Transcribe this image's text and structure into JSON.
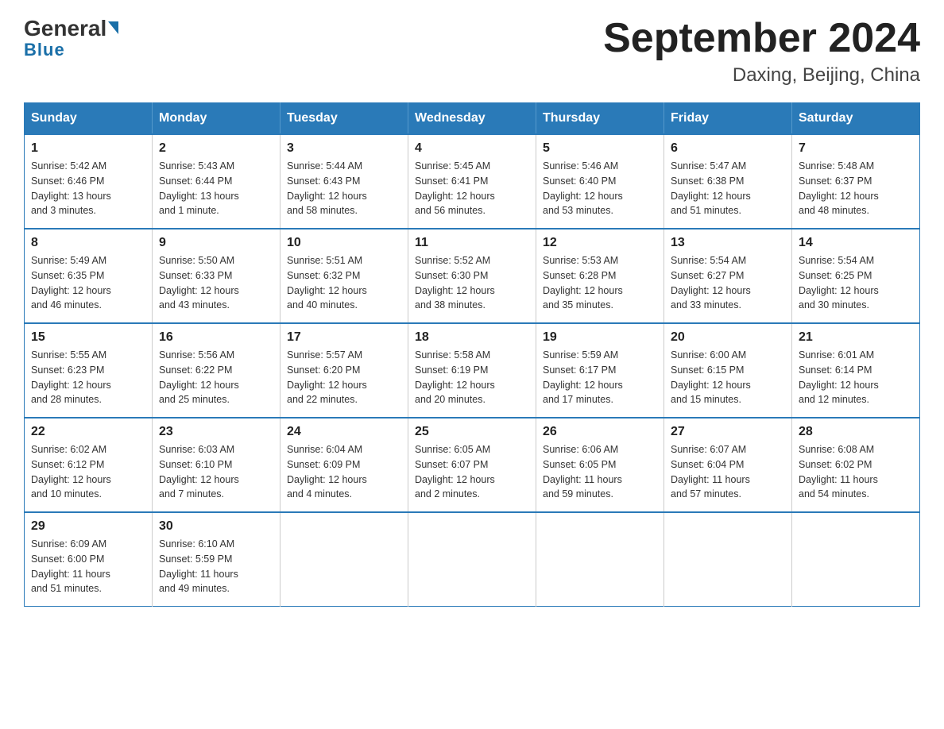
{
  "header": {
    "logo_general": "General",
    "logo_blue": "Blue",
    "title": "September 2024",
    "subtitle": "Daxing, Beijing, China"
  },
  "calendar": {
    "days_of_week": [
      "Sunday",
      "Monday",
      "Tuesday",
      "Wednesday",
      "Thursday",
      "Friday",
      "Saturday"
    ],
    "weeks": [
      [
        {
          "day": "1",
          "sunrise": "5:42 AM",
          "sunset": "6:46 PM",
          "daylight": "13 hours and 3 minutes."
        },
        {
          "day": "2",
          "sunrise": "5:43 AM",
          "sunset": "6:44 PM",
          "daylight": "13 hours and 1 minute."
        },
        {
          "day": "3",
          "sunrise": "5:44 AM",
          "sunset": "6:43 PM",
          "daylight": "12 hours and 58 minutes."
        },
        {
          "day": "4",
          "sunrise": "5:45 AM",
          "sunset": "6:41 PM",
          "daylight": "12 hours and 56 minutes."
        },
        {
          "day": "5",
          "sunrise": "5:46 AM",
          "sunset": "6:40 PM",
          "daylight": "12 hours and 53 minutes."
        },
        {
          "day": "6",
          "sunrise": "5:47 AM",
          "sunset": "6:38 PM",
          "daylight": "12 hours and 51 minutes."
        },
        {
          "day": "7",
          "sunrise": "5:48 AM",
          "sunset": "6:37 PM",
          "daylight": "12 hours and 48 minutes."
        }
      ],
      [
        {
          "day": "8",
          "sunrise": "5:49 AM",
          "sunset": "6:35 PM",
          "daylight": "12 hours and 46 minutes."
        },
        {
          "day": "9",
          "sunrise": "5:50 AM",
          "sunset": "6:33 PM",
          "daylight": "12 hours and 43 minutes."
        },
        {
          "day": "10",
          "sunrise": "5:51 AM",
          "sunset": "6:32 PM",
          "daylight": "12 hours and 40 minutes."
        },
        {
          "day": "11",
          "sunrise": "5:52 AM",
          "sunset": "6:30 PM",
          "daylight": "12 hours and 38 minutes."
        },
        {
          "day": "12",
          "sunrise": "5:53 AM",
          "sunset": "6:28 PM",
          "daylight": "12 hours and 35 minutes."
        },
        {
          "day": "13",
          "sunrise": "5:54 AM",
          "sunset": "6:27 PM",
          "daylight": "12 hours and 33 minutes."
        },
        {
          "day": "14",
          "sunrise": "5:54 AM",
          "sunset": "6:25 PM",
          "daylight": "12 hours and 30 minutes."
        }
      ],
      [
        {
          "day": "15",
          "sunrise": "5:55 AM",
          "sunset": "6:23 PM",
          "daylight": "12 hours and 28 minutes."
        },
        {
          "day": "16",
          "sunrise": "5:56 AM",
          "sunset": "6:22 PM",
          "daylight": "12 hours and 25 minutes."
        },
        {
          "day": "17",
          "sunrise": "5:57 AM",
          "sunset": "6:20 PM",
          "daylight": "12 hours and 22 minutes."
        },
        {
          "day": "18",
          "sunrise": "5:58 AM",
          "sunset": "6:19 PM",
          "daylight": "12 hours and 20 minutes."
        },
        {
          "day": "19",
          "sunrise": "5:59 AM",
          "sunset": "6:17 PM",
          "daylight": "12 hours and 17 minutes."
        },
        {
          "day": "20",
          "sunrise": "6:00 AM",
          "sunset": "6:15 PM",
          "daylight": "12 hours and 15 minutes."
        },
        {
          "day": "21",
          "sunrise": "6:01 AM",
          "sunset": "6:14 PM",
          "daylight": "12 hours and 12 minutes."
        }
      ],
      [
        {
          "day": "22",
          "sunrise": "6:02 AM",
          "sunset": "6:12 PM",
          "daylight": "12 hours and 10 minutes."
        },
        {
          "day": "23",
          "sunrise": "6:03 AM",
          "sunset": "6:10 PM",
          "daylight": "12 hours and 7 minutes."
        },
        {
          "day": "24",
          "sunrise": "6:04 AM",
          "sunset": "6:09 PM",
          "daylight": "12 hours and 4 minutes."
        },
        {
          "day": "25",
          "sunrise": "6:05 AM",
          "sunset": "6:07 PM",
          "daylight": "12 hours and 2 minutes."
        },
        {
          "day": "26",
          "sunrise": "6:06 AM",
          "sunset": "6:05 PM",
          "daylight": "11 hours and 59 minutes."
        },
        {
          "day": "27",
          "sunrise": "6:07 AM",
          "sunset": "6:04 PM",
          "daylight": "11 hours and 57 minutes."
        },
        {
          "day": "28",
          "sunrise": "6:08 AM",
          "sunset": "6:02 PM",
          "daylight": "11 hours and 54 minutes."
        }
      ],
      [
        {
          "day": "29",
          "sunrise": "6:09 AM",
          "sunset": "6:00 PM",
          "daylight": "11 hours and 51 minutes."
        },
        {
          "day": "30",
          "sunrise": "6:10 AM",
          "sunset": "5:59 PM",
          "daylight": "11 hours and 49 minutes."
        },
        null,
        null,
        null,
        null,
        null
      ]
    ]
  }
}
